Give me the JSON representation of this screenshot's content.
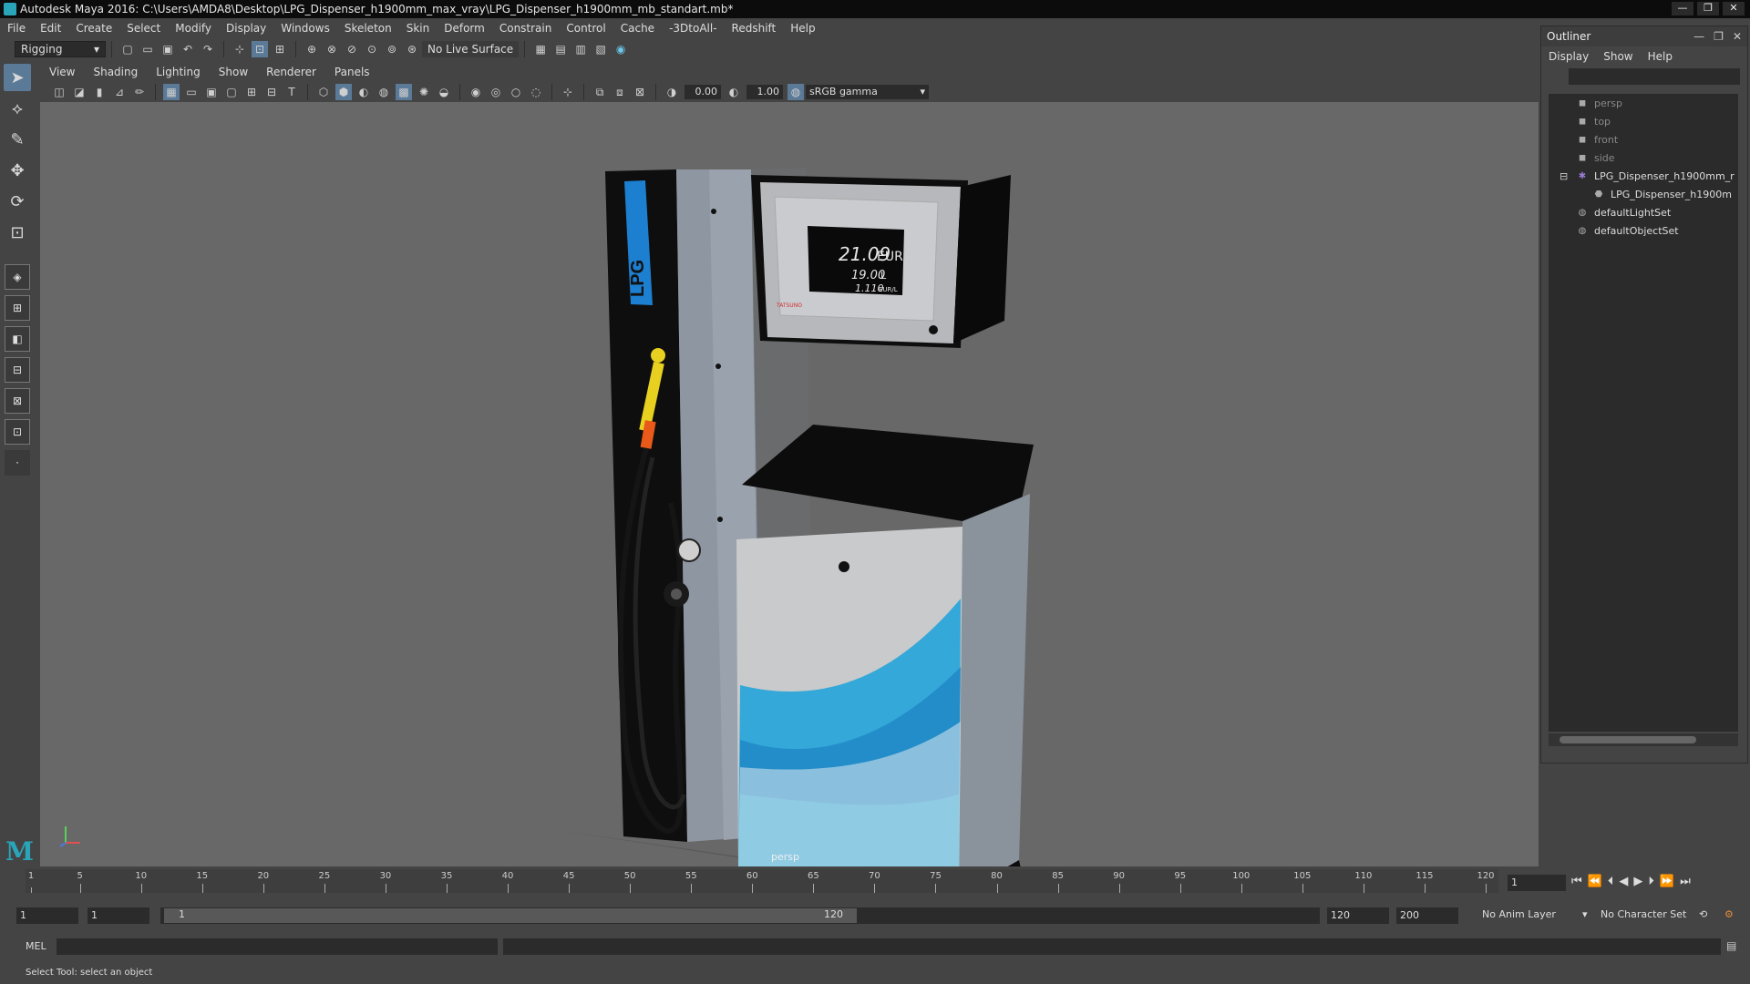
{
  "window": {
    "title": "Autodesk Maya 2016: C:\\Users\\AMDA8\\Desktop\\LPG_Dispenser_h1900mm_max_vray\\LPG_Dispenser_h1900mm_mb_standart.mb*",
    "controls": [
      "—",
      "❐",
      "✕"
    ]
  },
  "menubar": [
    "File",
    "Edit",
    "Create",
    "Select",
    "Modify",
    "Display",
    "Windows",
    "Skeleton",
    "Skin",
    "Deform",
    "Constrain",
    "Control",
    "Cache",
    "-3DtoAll-",
    "Redshift",
    "Help"
  ],
  "statusline": {
    "mode": "Rigging",
    "live_surface": "No Live Surface"
  },
  "viewport": {
    "menu": [
      "View",
      "Shading",
      "Lighting",
      "Show",
      "Renderer",
      "Panels"
    ],
    "exposure": "0.00",
    "gamma": "1.00",
    "color_space": "sRGB gamma",
    "camera_label": "persp"
  },
  "model": {
    "price": "21.09",
    "price_unit": "EUR",
    "volume": "19.00",
    "volume_unit": "L",
    "unit_price": "1.110",
    "unit_price_unit": "EUR/L",
    "brand": "TATSUNO",
    "column_label": "LPG",
    "colors": {
      "accent": "#1d7fd0",
      "body": "#8e96a2",
      "top": "#101010"
    }
  },
  "outliner": {
    "title": "Outliner",
    "menu": [
      "Display",
      "Show",
      "Help"
    ],
    "items": [
      {
        "label": "persp",
        "type": "camera"
      },
      {
        "label": "top",
        "type": "camera"
      },
      {
        "label": "front",
        "type": "camera"
      },
      {
        "label": "side",
        "type": "camera"
      },
      {
        "label": "LPG_Dispenser_h1900mm_r",
        "type": "group"
      },
      {
        "label": "LPG_Dispenser_h1900m",
        "type": "mesh"
      },
      {
        "label": "defaultLightSet",
        "type": "set"
      },
      {
        "label": "defaultObjectSet",
        "type": "set"
      }
    ]
  },
  "timeline": {
    "ticks": [
      1,
      5,
      10,
      15,
      20,
      25,
      30,
      35,
      40,
      45,
      50,
      55,
      60,
      65,
      70,
      75,
      80,
      85,
      90,
      95,
      100,
      105,
      110,
      115,
      120
    ],
    "current_frame": "1"
  },
  "range": {
    "start": "1",
    "playback_start": "1",
    "slider_start": "1",
    "slider_end": "120",
    "playback_end": "120",
    "end": "200",
    "anim_layer": "No Anim Layer",
    "character_set": "No Character Set"
  },
  "cmdline": {
    "label": "MEL"
  },
  "help_line": "Select Tool: select an object"
}
